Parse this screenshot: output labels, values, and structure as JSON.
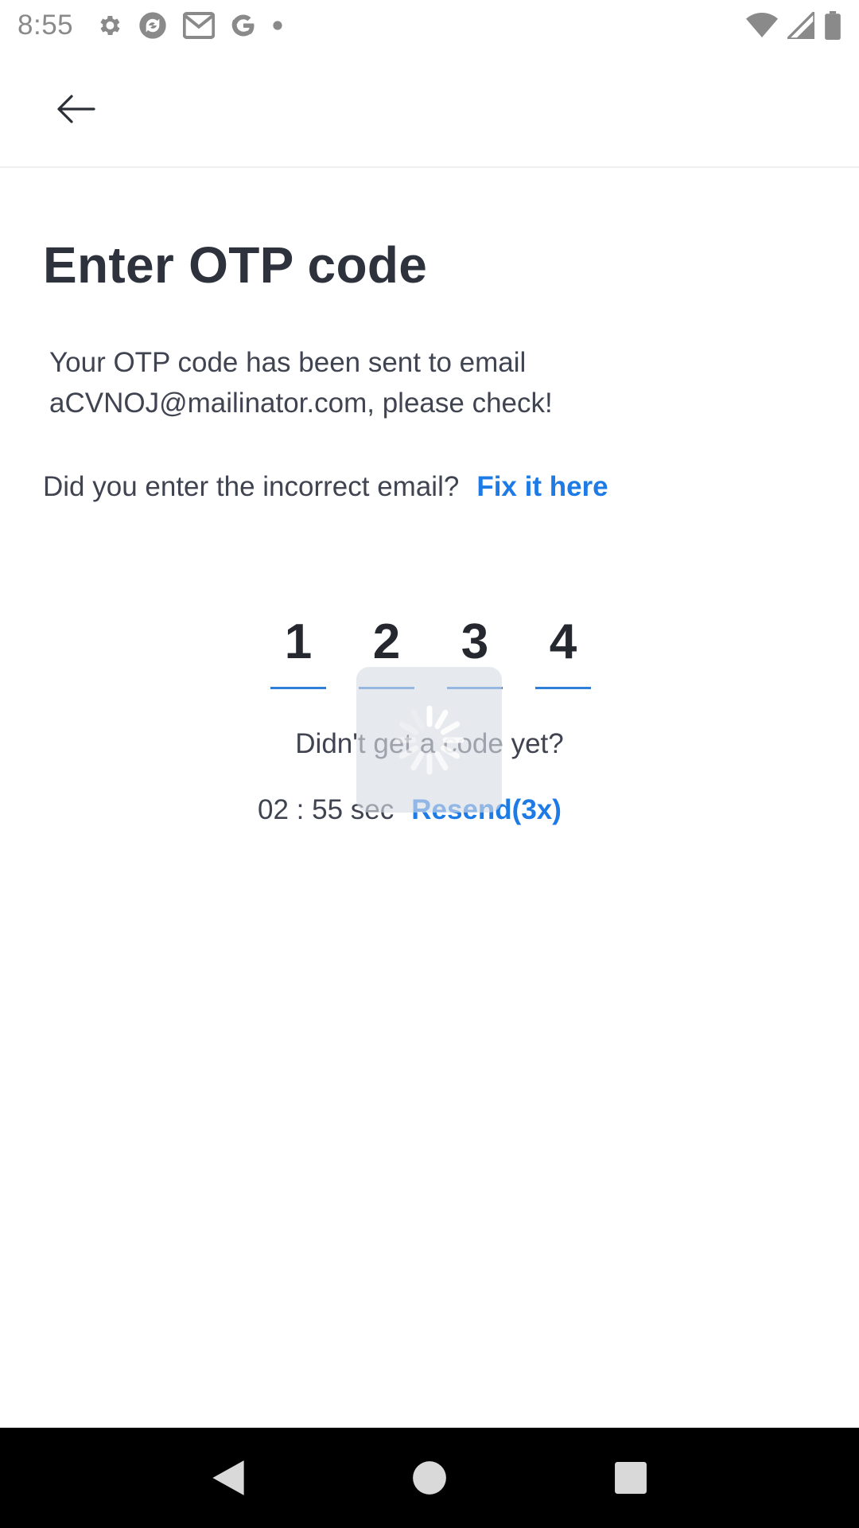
{
  "status_bar": {
    "time": "8:55",
    "icons": [
      "settings-icon",
      "sync-icon",
      "gmail-icon",
      "google-icon",
      "dot-icon"
    ],
    "right_icons": [
      "wifi-icon",
      "signal-icon",
      "battery-icon"
    ]
  },
  "header": {
    "back_icon": "arrow-left-icon"
  },
  "main": {
    "title": "Enter OTP code",
    "subtitle_line1": "Your OTP code has been sent to email",
    "subtitle_line2": "aCVNOJ@mailinator.com, please check!",
    "incorrect_prompt": "Did you enter the incorrect email?",
    "fix_link": "Fix it here",
    "otp_digits": [
      "1",
      "2",
      "3",
      "4"
    ],
    "didnt_get_code": "Didn't get a code yet?",
    "timer": "02 : 55 sec",
    "resend_link": "Resend(3x)"
  },
  "loading": {
    "icon": "spinner-icon"
  },
  "nav_bar": {
    "icons": [
      "back-triangle-icon",
      "home-circle-icon",
      "recents-square-icon"
    ]
  },
  "colors": {
    "accent": "#1e7be6",
    "text": "#2e323c",
    "muted": "#8a8a8a"
  }
}
